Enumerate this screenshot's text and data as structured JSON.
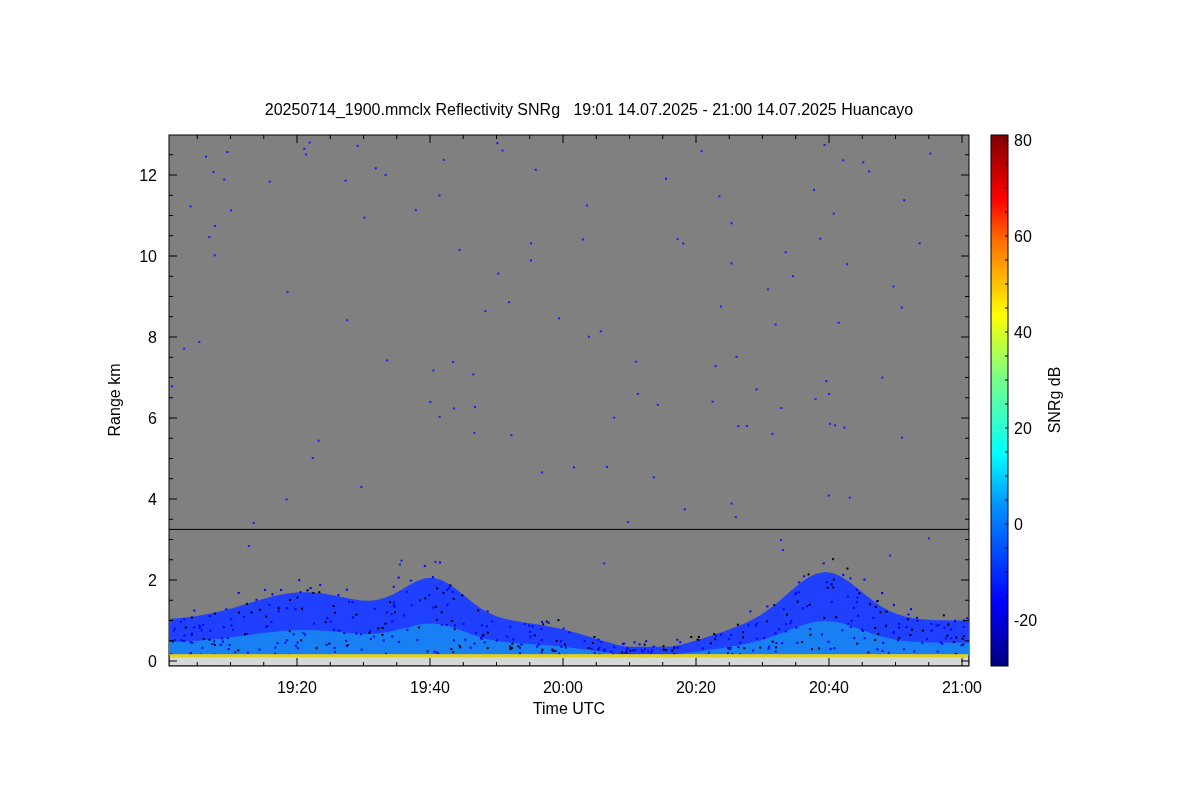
{
  "title": "20250714_1900.mmclx Reflectivity SNRg   19:01 14.07.2025 - 21:00 14.07.2025 Huancayo",
  "plot": {
    "xlabel": "Time UTC",
    "ylabel": "Range km",
    "xtick_labels": [
      "19:20",
      "19:40",
      "20:00",
      "20:20",
      "20:40",
      "21:00"
    ],
    "ytick_labels": [
      "12",
      "10",
      "8",
      "6",
      "4",
      "2",
      "0"
    ]
  },
  "colorbar": {
    "label": "SNRg dB",
    "tick_labels": [
      "80",
      "60",
      "40",
      "20",
      "0",
      "-20"
    ]
  }
}
